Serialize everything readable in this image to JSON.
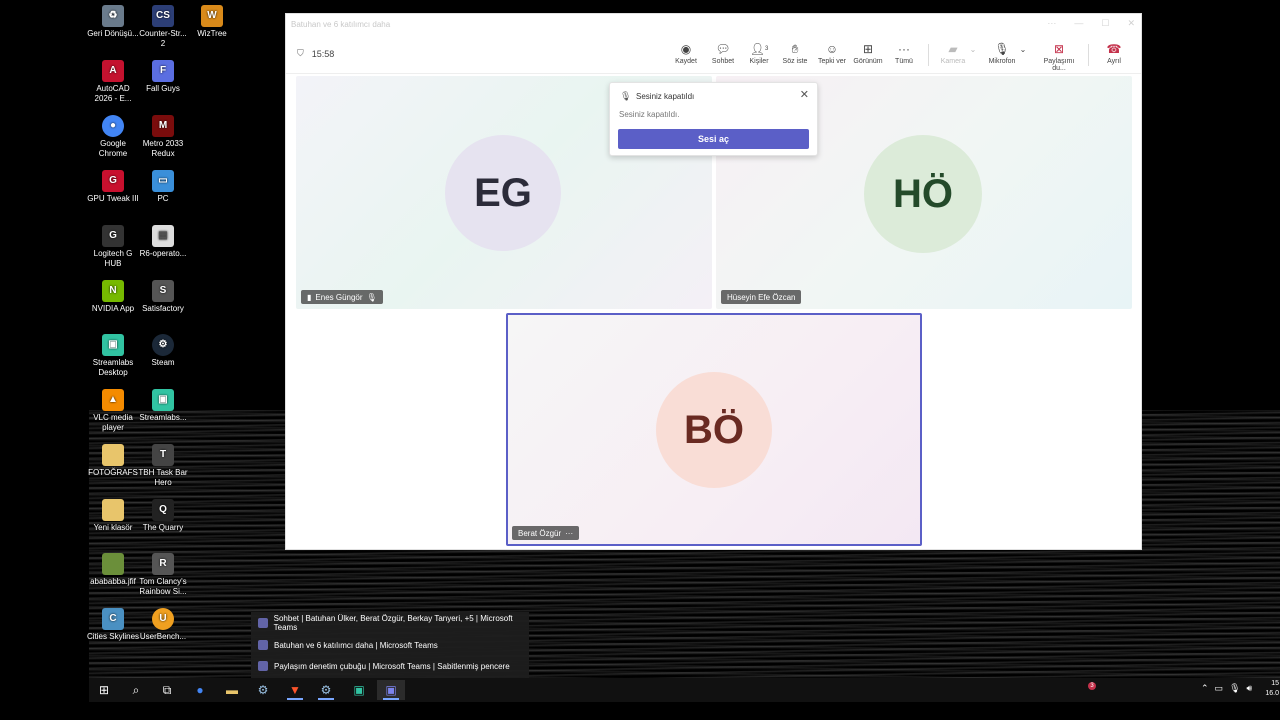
{
  "desktop_icons": [
    {
      "label": "Geri Dönüşü...",
      "icon": "recycle-bin-icon",
      "color": "#6a7b8c"
    },
    {
      "label": "Counter-Str... 2",
      "icon": "counter-strike-icon",
      "color": "#2c3e76"
    },
    {
      "label": "WizTree",
      "icon": "wiztree-icon",
      "color": "#d98a1a"
    },
    {
      "label": "AutoCAD 2026 - E...",
      "icon": "autocad-icon",
      "color": "#c4122f"
    },
    {
      "label": "Fall Guys",
      "icon": "fall-guys-icon",
      "color": "#5b6ee1"
    },
    {
      "label": "Google Chrome",
      "icon": "chrome-icon",
      "color": "#4285f4"
    },
    {
      "label": "Metro 2033 Redux",
      "icon": "metro-icon",
      "color": "#7a0c0c"
    },
    {
      "label": "GPU Tweak III",
      "icon": "gpu-tweak-icon",
      "color": "#c8102e"
    },
    {
      "label": "PC",
      "icon": "pc-icon",
      "color": "#3a8fd9"
    },
    {
      "label": "Logitech G HUB",
      "icon": "logitech-icon",
      "color": "#333333"
    },
    {
      "label": "R6-operato...",
      "icon": "file-icon",
      "color": "#dddddd"
    },
    {
      "label": "NVIDIA App",
      "icon": "nvidia-icon",
      "color": "#76b900"
    },
    {
      "label": "Satisfactory",
      "icon": "satisfactory-icon",
      "color": "#555555"
    },
    {
      "label": "Streamlabs Desktop",
      "icon": "streamlabs-icon",
      "color": "#31c3a2"
    },
    {
      "label": "Steam",
      "icon": "steam-icon",
      "color": "#1b2838"
    },
    {
      "label": "VLC media player",
      "icon": "vlc-icon",
      "color": "#f48b00"
    },
    {
      "label": "Streamlabs...",
      "icon": "streamlabs-icon",
      "color": "#31c3a2"
    },
    {
      "label": "FOTOĞRAFS",
      "icon": "folder-icon",
      "color": "#e8c56b"
    },
    {
      "label": "TBH Task Bar Hero",
      "icon": "tbh-icon",
      "color": "#444444"
    },
    {
      "label": "Yeni klasör",
      "icon": "folder-icon",
      "color": "#e8c56b"
    },
    {
      "label": "The Quarry",
      "icon": "quarry-icon",
      "color": "#222222"
    },
    {
      "label": "abababba.jfif",
      "icon": "image-file-icon",
      "color": "#6b8f3a"
    },
    {
      "label": "Tom Clancy's Rainbow Si...",
      "icon": "rainbow-six-icon",
      "color": "#555555"
    },
    {
      "label": "Cities Skylines",
      "icon": "cities-skylines-icon",
      "color": "#4a90c2"
    },
    {
      "label": "UserBench...",
      "icon": "userbench-icon",
      "color": "#f0a020"
    }
  ],
  "teams": {
    "window_title": "Batuhan ve 6 katılımcı daha",
    "time": "15:58",
    "toolbar": [
      {
        "label": "Kaydet",
        "icon": "record-icon"
      },
      {
        "label": "Sohbet",
        "icon": "chat-icon"
      },
      {
        "label": "Kişiler",
        "icon": "people-icon",
        "count": "3"
      },
      {
        "label": "Söz iste",
        "icon": "raise-hand-icon"
      },
      {
        "label": "Tepki ver",
        "icon": "react-icon"
      },
      {
        "label": "Görünüm",
        "icon": "view-icon"
      },
      {
        "label": "Tümü",
        "icon": "more-icon"
      },
      {
        "label": "Kamera",
        "icon": "camera-off-icon"
      },
      {
        "label": "Mikrofon",
        "icon": "mic-off-icon"
      },
      {
        "label": "Paylaşımı du...",
        "icon": "stop-share-icon"
      },
      {
        "label": "Ayrıl",
        "icon": "leave-call-icon"
      }
    ],
    "participants": [
      {
        "initials": "EG",
        "name": "Enes Güngör",
        "color": "#e6e3f0",
        "text_color": "#2c2c3a"
      },
      {
        "initials": "HÖ",
        "name": "Hüseyin Efe Özcan",
        "color": "#dcebd9",
        "text_color": "#244a2a"
      },
      {
        "initials": "BÖ",
        "name": "Berat Özgür",
        "color": "#f9ddd6",
        "text_color": "#6a2a22"
      }
    ],
    "popup": {
      "title": "Sesiniz kapatıldı",
      "body": "Sesiniz kapatıldı.",
      "button": "Sesi aç"
    }
  },
  "jumplist": [
    "Sohbet | Batuhan Ülker, Berat Özgür, Berkay Tanyeri, +5 | Microsoft Teams",
    "Batuhan ve 6 katılımcı daha | Microsoft Teams",
    "Paylaşım denetim çubuğu | Microsoft Teams | Sabitlenmiş pencere"
  ],
  "taskbar": {
    "badge": "3",
    "clock_time": "15",
    "clock_date": "16.0"
  },
  "colors": {
    "accent": "#5b5fc7",
    "leave": "#c4314b"
  }
}
